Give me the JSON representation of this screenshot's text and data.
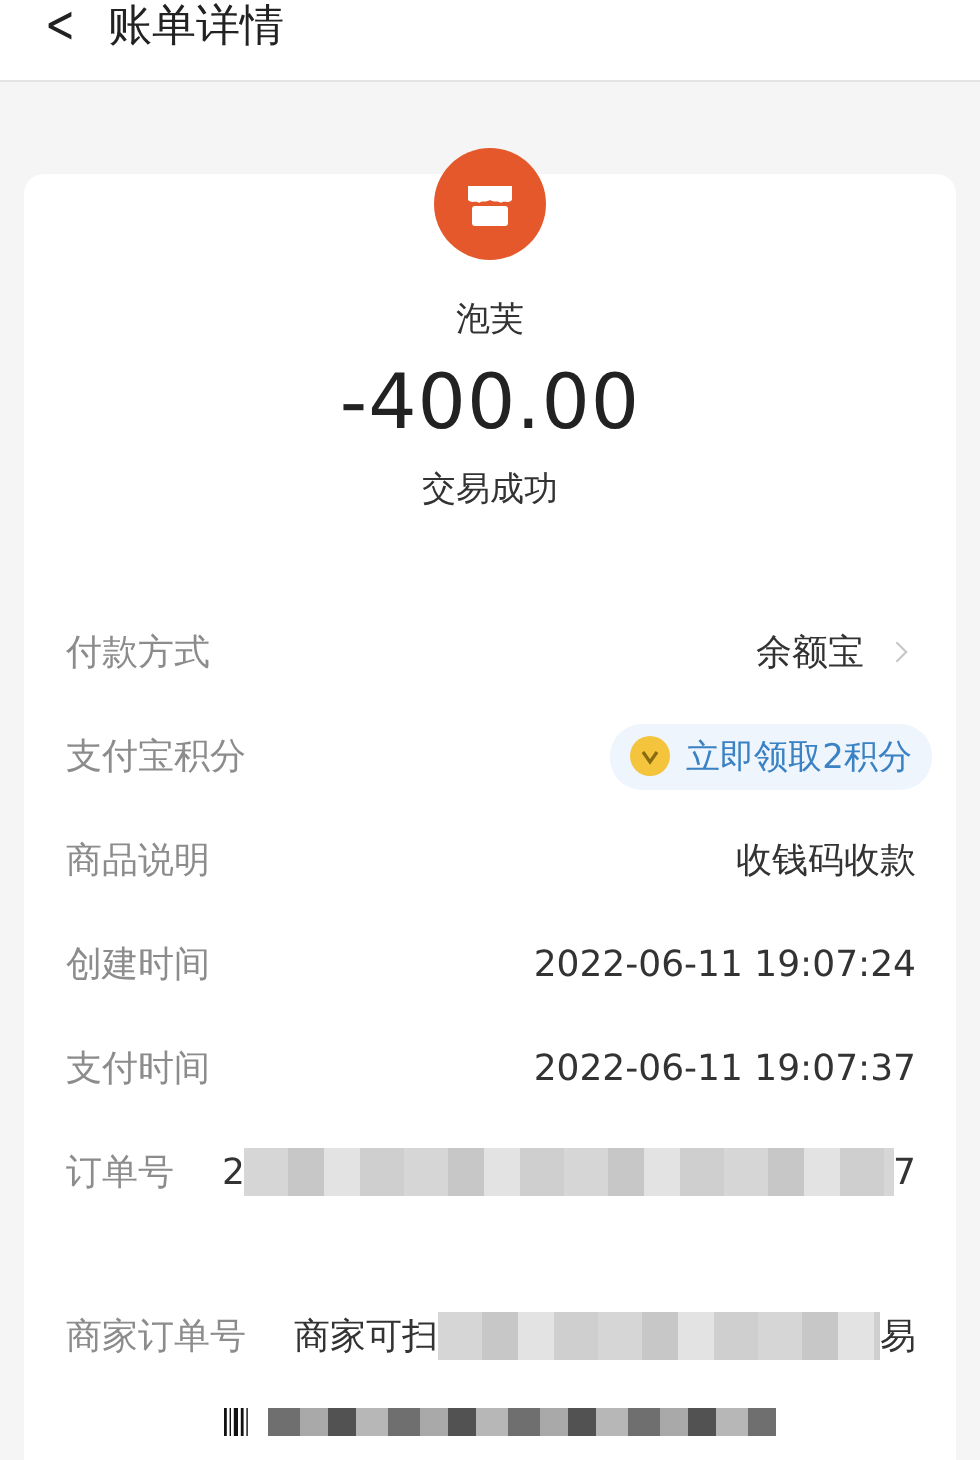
{
  "header": {
    "back": "<",
    "title": "账单详情"
  },
  "summary": {
    "merchant": "泡芙",
    "amount": "-400.00",
    "status": "交易成功"
  },
  "rows": [
    {
      "kind": "link",
      "label": "付款方式",
      "value": "余额宝"
    },
    {
      "kind": "points",
      "label": "支付宝积分",
      "value": "立即领取2积分"
    },
    {
      "kind": "text",
      "label": "商品说明",
      "value": "收钱码收款"
    },
    {
      "kind": "text",
      "label": "创建时间",
      "value": "2022-06-11 19:07:24"
    },
    {
      "kind": "text",
      "label": "支付时间",
      "value": "2022-06-11 19:07:37"
    },
    {
      "kind": "redacted",
      "label": "订单号",
      "value_start": "2",
      "value_end": "7"
    },
    {
      "kind": "redacted",
      "label": "商家订单号",
      "value_start": "商家可扫",
      "value_end": "易"
    }
  ],
  "barcode": {
    "redacted": true
  }
}
